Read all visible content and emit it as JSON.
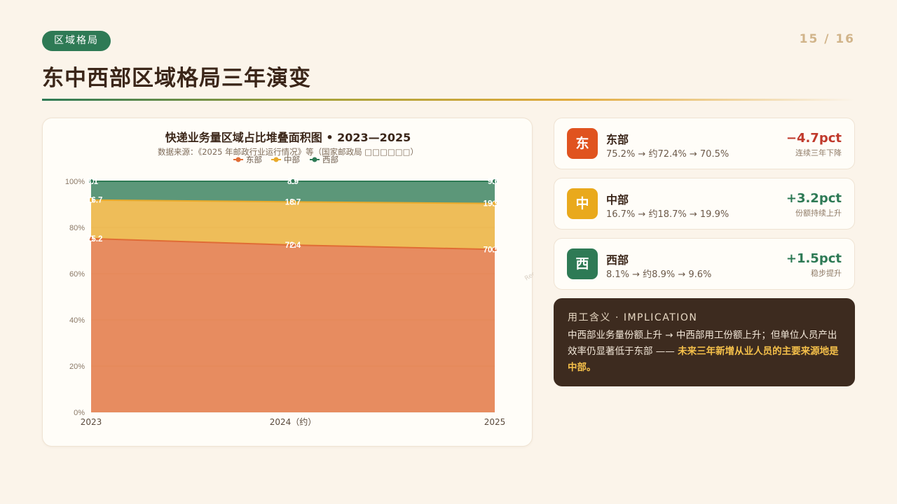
{
  "header": {
    "tag": "区域格局",
    "page": "15 / 16",
    "title": "东中西部区域格局三年演变"
  },
  "chart_card": {
    "title": "快递业务量区域占比堆叠面积图 • 2023—2025",
    "source": "数据来源：《2025 年邮政行业运行情况》等（国家邮政局 □□□□□□）",
    "watermark": "Report @ 全球精选报告.com"
  },
  "chart_data": {
    "type": "area",
    "stacked": true,
    "title": "快递业务量区域占比堆叠面积图 • 2023—2025",
    "categories": [
      "2023",
      "2024（约）",
      "2025"
    ],
    "ylim": [
      0,
      100
    ],
    "yticks": [
      "0%",
      "20%",
      "40%",
      "60%",
      "80%",
      "100%"
    ],
    "grid": true,
    "legend_position": "top-center",
    "series": [
      {
        "name": "东部",
        "values": [
          75.2,
          72.4,
          70.5
        ],
        "color": "#e06c35",
        "labels": [
          "75.2",
          "72.4",
          "70.5"
        ]
      },
      {
        "name": "中部",
        "values": [
          16.7,
          18.7,
          19.9
        ],
        "color": "#e9aa2b",
        "labels": [
          "16.7",
          "18.7",
          "19.9"
        ]
      },
      {
        "name": "西部",
        "values": [
          8.1,
          8.9,
          9.6
        ],
        "color": "#2e7a55",
        "labels": [
          "8.1",
          "8.9",
          "9.6"
        ]
      }
    ]
  },
  "cards": [
    {
      "icon_char": "东",
      "name": "东部",
      "seq": "75.2% → 约72.4% → 70.5%",
      "delta": "−4.7pct",
      "note": "连续三年下降",
      "color": "#e0531f",
      "delta_color": "#c0392b"
    },
    {
      "icon_char": "中",
      "name": "中部",
      "seq": "16.7% → 约18.7% → 19.9%",
      "delta": "+3.2pct",
      "note": "份额持续上升",
      "color": "#e9a91c",
      "delta_color": "#2e7a55"
    },
    {
      "icon_char": "西",
      "name": "西部",
      "seq": "8.1% → 约8.9% → 9.6%",
      "delta": "+1.5pct",
      "note": "稳步提升",
      "color": "#2e7a55",
      "delta_color": "#2e7a55"
    }
  ],
  "implication": {
    "head": "用工含义 · IMPLICATION",
    "body": "中西部业务量份额上升 → 中西部用工份额上升；但单位人员产出效率仍显著低于东部 —— ",
    "highlight": "未来三年新增从业人员的主要来源地是中部。"
  }
}
